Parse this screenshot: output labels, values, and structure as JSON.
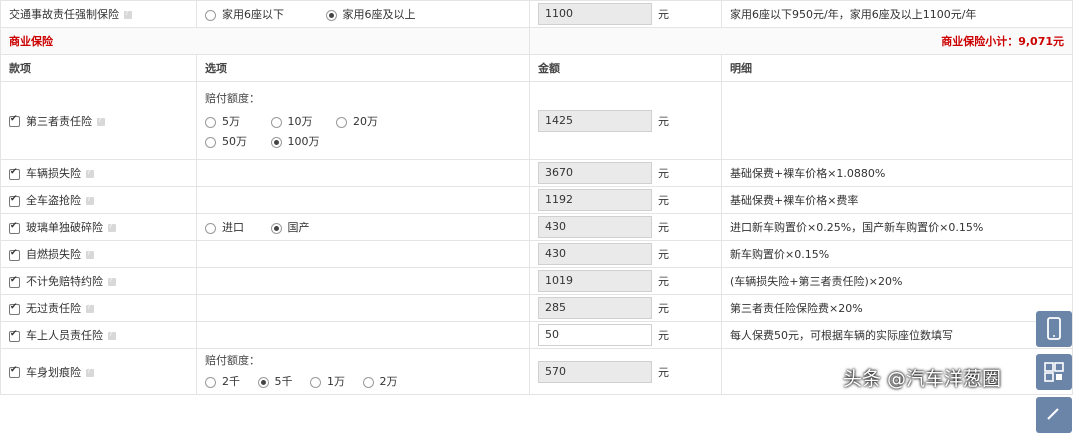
{
  "compulsory": {
    "name": "交通事故责任强制保险",
    "options": [
      {
        "label": "家用6座以下",
        "selected": false
      },
      {
        "label": "家用6座及以上",
        "selected": true
      }
    ],
    "amount": "1100",
    "unit": "元",
    "detail": "家用6座以下950元/年，家用6座及以上1100元/年"
  },
  "commercial": {
    "title": "商业保险",
    "subtotal": "商业保险小计：9,071元"
  },
  "headers": {
    "item": "款项",
    "option": "选项",
    "amount": "金额",
    "detail": "明细"
  },
  "rows": [
    {
      "name": "第三者责任险",
      "option_title": "赔付额度：",
      "options": [
        {
          "label": "5万",
          "selected": false
        },
        {
          "label": "10万",
          "selected": false
        },
        {
          "label": "20万",
          "selected": false
        },
        {
          "label": "50万",
          "selected": false
        },
        {
          "label": "100万",
          "selected": true
        }
      ],
      "amount": "1425",
      "unit": "元",
      "detail": ""
    },
    {
      "name": "车辆损失险",
      "amount": "3670",
      "unit": "元",
      "detail": "基础保费+裸车价格×1.0880%"
    },
    {
      "name": "全车盗抢险",
      "amount": "1192",
      "unit": "元",
      "detail": "基础保费+裸车价格×费率"
    },
    {
      "name": "玻璃单独破碎险",
      "options": [
        {
          "label": "进口",
          "selected": false
        },
        {
          "label": "国产",
          "selected": true
        }
      ],
      "amount": "430",
      "unit": "元",
      "detail": "进口新车购置价×0.25%，国产新车购置价×0.15%"
    },
    {
      "name": "自燃损失险",
      "amount": "430",
      "unit": "元",
      "detail": "新车购置价×0.15%"
    },
    {
      "name": "不计免赔特约险",
      "amount": "1019",
      "unit": "元",
      "detail": "(车辆损失险+第三者责任险)×20%"
    },
    {
      "name": "无过责任险",
      "amount": "285",
      "unit": "元",
      "detail": "第三者责任险保险费×20%"
    },
    {
      "name": "车上人员责任险",
      "amount": "50",
      "unit": "元",
      "detail": "每人保费50元，可根据车辆的实际座位数填写"
    },
    {
      "name": "车身划痕险",
      "option_title": "赔付额度：",
      "options": [
        {
          "label": "2千",
          "selected": false
        },
        {
          "label": "5千",
          "selected": true
        },
        {
          "label": "1万",
          "selected": false
        },
        {
          "label": "2万",
          "selected": false
        }
      ],
      "amount": "570",
      "unit": "元",
      "detail": ""
    }
  ],
  "watermark": "头条 @汽车洋葱圈",
  "colors": {
    "accent": "#cc0000",
    "side_button": "#6b85a8"
  }
}
